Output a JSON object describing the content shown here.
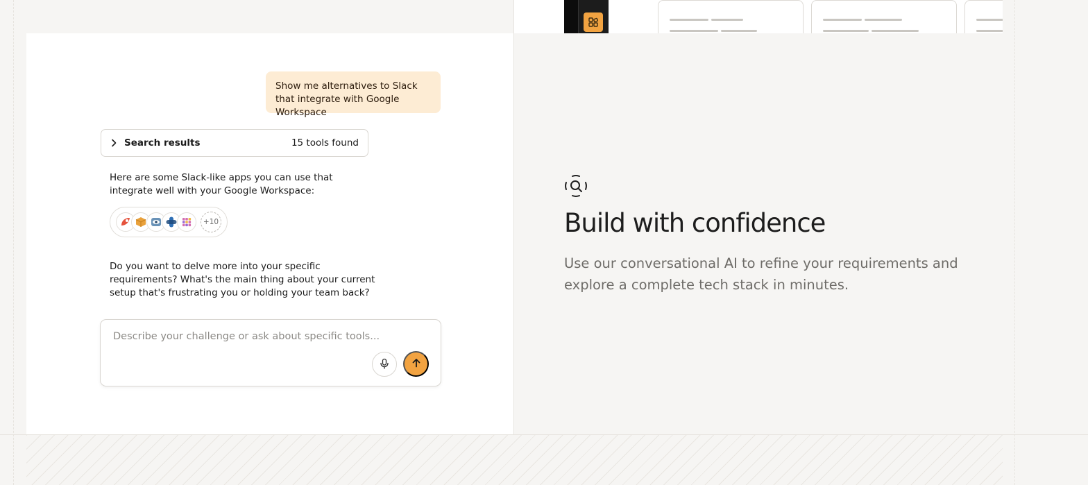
{
  "chat": {
    "user_message": "Show me alternatives to Slack that integrate with Google Workspace",
    "search_results": {
      "label": "Search results",
      "count_text": "15 tools found"
    },
    "reply_intro": "Here are some Slack-like apps you can use that integrate well with your Google Workspace:",
    "logos": [
      "rocket-chat-icon",
      "box-icon",
      "eye-app-icon",
      "pin-app-icon",
      "cube-app-icon"
    ],
    "more_count": "+10",
    "reply_followup": "Do you want to delve more into your specific requirements? What's the main thing about your current setup that's frustrating you or holding your team back?",
    "composer": {
      "placeholder": "Describe your challenge or ask about specific tools..."
    }
  },
  "feature": {
    "icon": "search-scan-icon",
    "title": "Build with confidence",
    "description": "Use our conversational AI to refine your requirements and explore a complete tech stack in minutes."
  },
  "colors": {
    "accent": "#f2a341",
    "bubble": "#fdecd4",
    "background": "#f6f5f3"
  }
}
